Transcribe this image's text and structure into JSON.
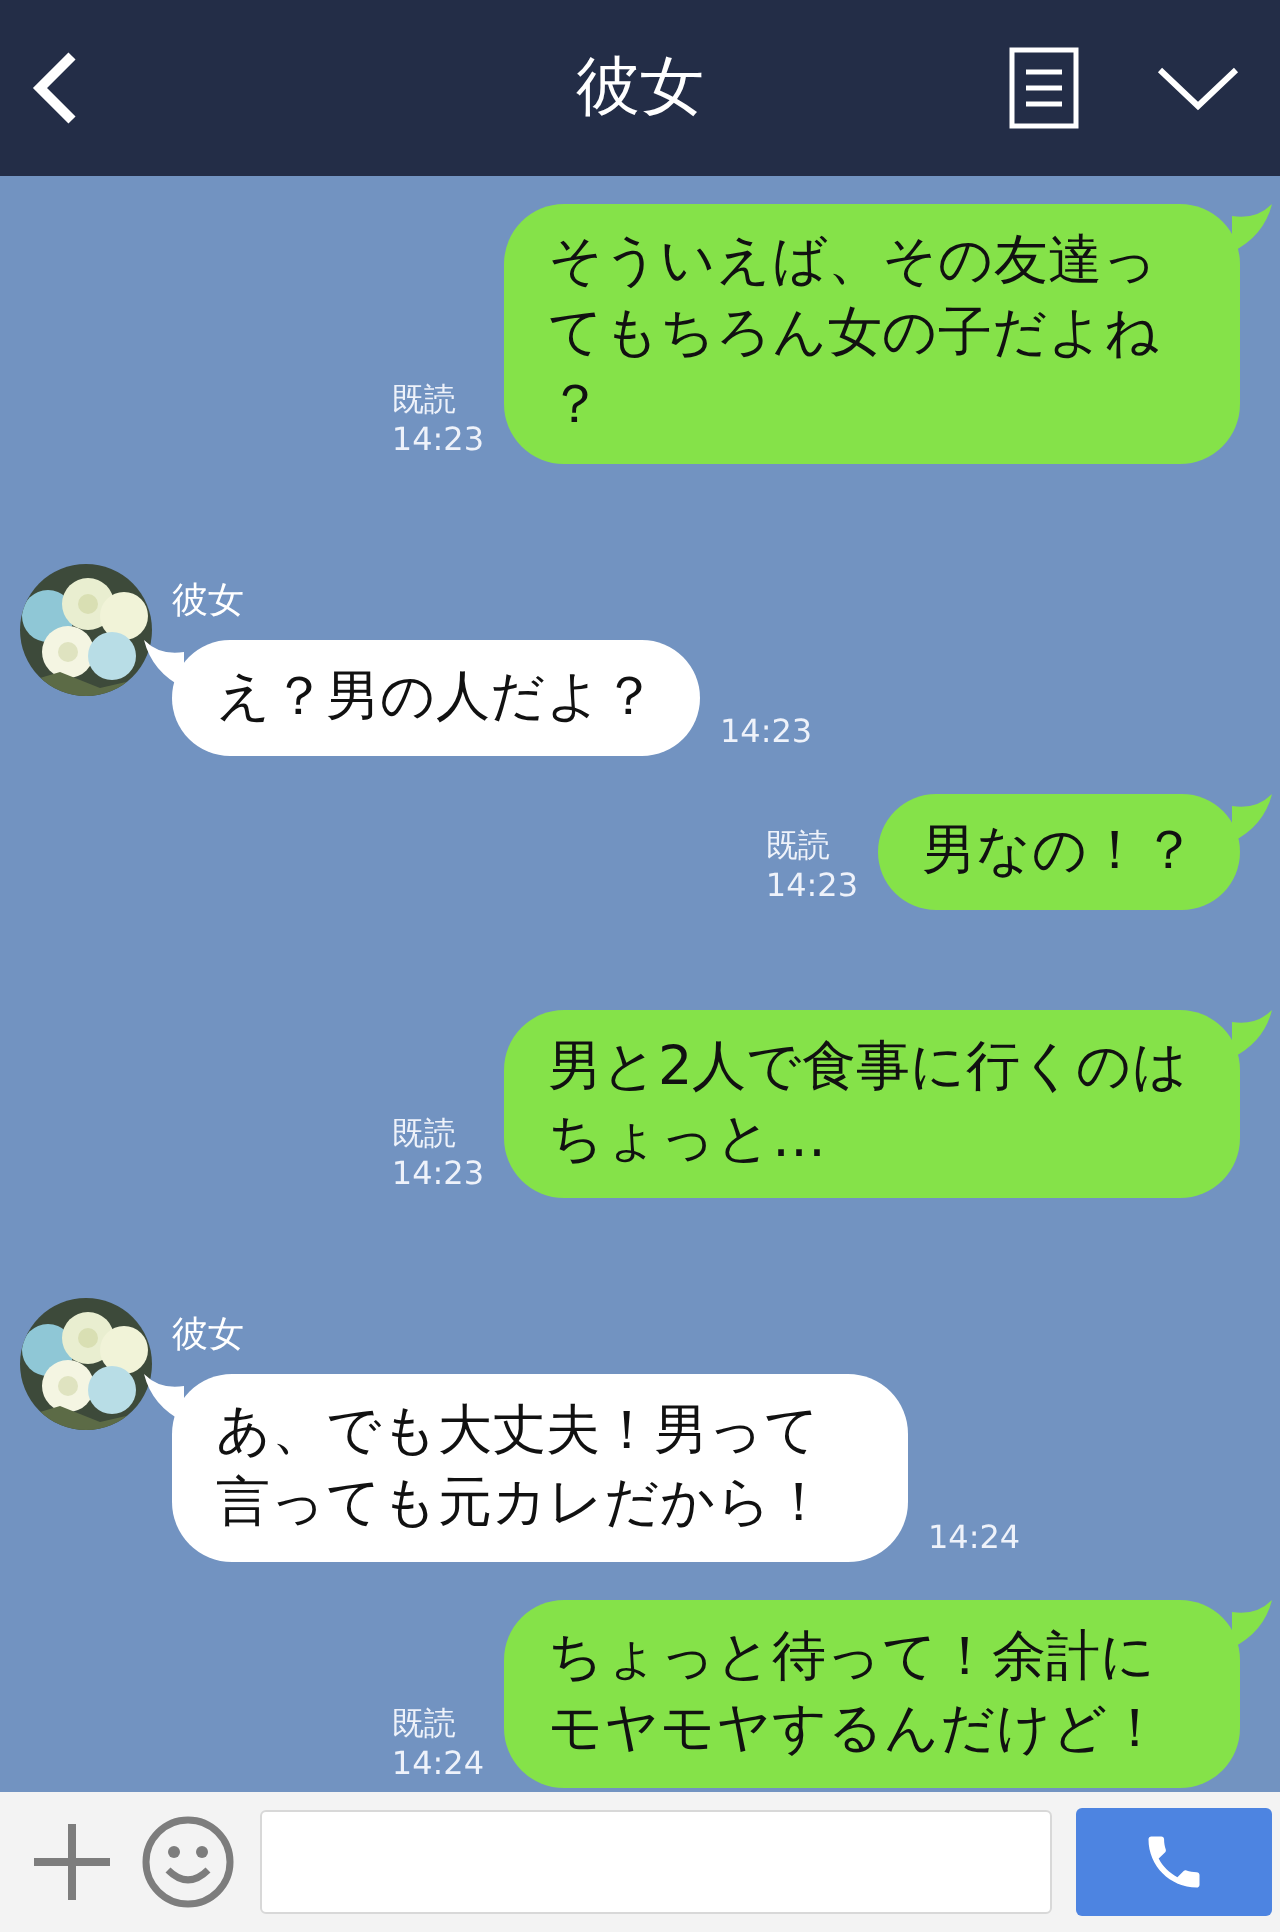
{
  "header": {
    "title": "彼女"
  },
  "messages": [
    {
      "kind": "sent",
      "text": "そういえば、その友達ってもちろん女の子だよね？",
      "read": "既読",
      "time": "14:23"
    },
    {
      "kind": "received",
      "sender": "彼女",
      "text": "え？男の人だよ？",
      "time": "14:23"
    },
    {
      "kind": "sent",
      "text": "男なの！？",
      "read": "既読",
      "time": "14:23"
    },
    {
      "kind": "sent",
      "text": "男と2人で食事に行くのはちょっと…",
      "read": "既読",
      "time": "14:23"
    },
    {
      "kind": "received",
      "sender": "彼女",
      "text": "あ、でも大丈夫！男って言っても元カレだから！",
      "time": "14:24"
    },
    {
      "kind": "sent",
      "text": "ちょっと待って！余計にモヤモヤするんだけど！",
      "read": "既読",
      "time": "14:24"
    }
  ]
}
